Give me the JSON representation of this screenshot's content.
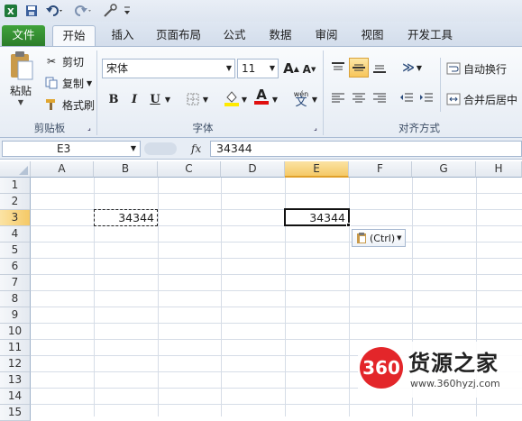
{
  "quick_access": {
    "icons": [
      "save-icon",
      "undo-icon",
      "redo-icon",
      "customize-icon"
    ]
  },
  "tabs": [
    "文件",
    "开始",
    "插入",
    "页面布局",
    "公式",
    "数据",
    "审阅",
    "视图",
    "开发工具"
  ],
  "ribbon": {
    "clipboard": {
      "paste": "粘贴",
      "cut": "剪切",
      "copy": "复制",
      "format_painter": "格式刷",
      "label": "剪贴板"
    },
    "font": {
      "name": "宋体",
      "size": "11",
      "bold": "B",
      "italic": "I",
      "underline": "U",
      "label": "字体",
      "grow": "A",
      "shrink": "A",
      "font_color": "A",
      "phonetic": "wén"
    },
    "alignment": {
      "wrap": "自动换行",
      "merge": "合并后居中",
      "label": "对齐方式"
    }
  },
  "formula_bar": {
    "name_box": "E3",
    "fx": "fx",
    "value": "34344"
  },
  "sheet": {
    "columns": [
      "A",
      "B",
      "C",
      "D",
      "E",
      "F",
      "G",
      "H"
    ],
    "rows": [
      "1",
      "2",
      "3",
      "4",
      "5",
      "6",
      "7",
      "8",
      "9",
      "10",
      "11",
      "12",
      "13",
      "14",
      "15"
    ],
    "selected_column": "E",
    "selected_row": "3",
    "cells": {
      "B3": "34344",
      "E3": "34344"
    },
    "paste_options": "(Ctrl)"
  },
  "watermark": {
    "brand_number": "360",
    "brand_name": "货源之家",
    "url": "www.360hyzj.com"
  }
}
